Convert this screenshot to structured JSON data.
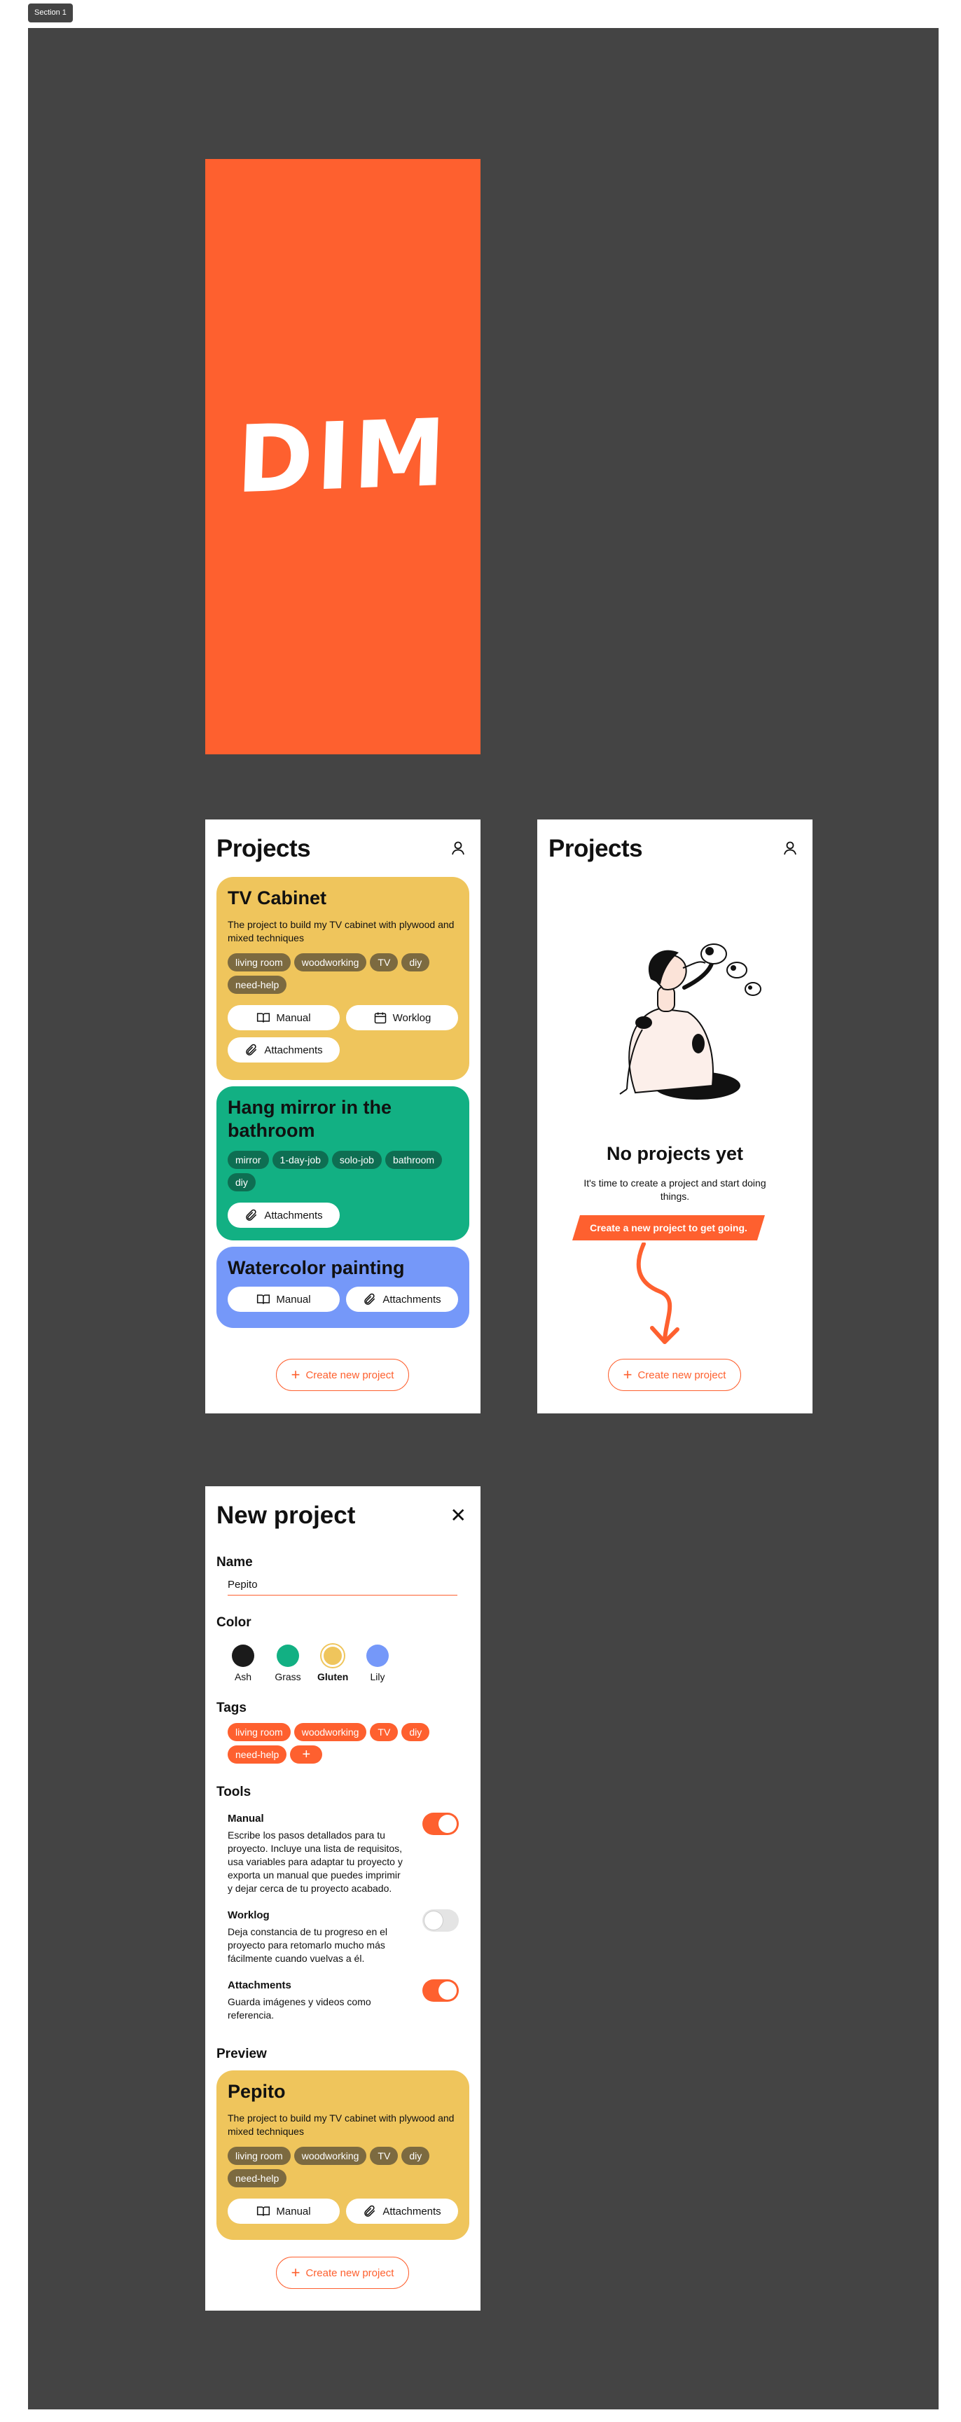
{
  "section_label": "Section 1",
  "splash": {
    "logo": "DIM"
  },
  "projects": {
    "title": "Projects",
    "cards": [
      {
        "title": "TV Cabinet",
        "description": "The project to build my TV cabinet with plywood and mixed techniques",
        "tags": [
          "living room",
          "woodworking",
          "TV",
          "diy",
          "need-help"
        ],
        "buttons": [
          "Manual",
          "Worklog",
          "Attachments"
        ]
      },
      {
        "title": "Hang mirror in the bathroom",
        "tags": [
          "mirror",
          "1-day-job",
          "solo-job",
          "bathroom",
          "diy"
        ],
        "buttons": [
          "Attachments"
        ]
      },
      {
        "title": "Watercolor painting",
        "buttons": [
          "Manual",
          "Attachments"
        ]
      }
    ],
    "create_label": "Create new project"
  },
  "empty": {
    "title": "Projects",
    "heading": "No projects yet",
    "subtitle": "It's time to create a project and start doing things.",
    "cta": "Create a new project to get going.",
    "create_label": "Create new project"
  },
  "new_project": {
    "title": "New project",
    "name_label": "Name",
    "name_value": "Pepito",
    "color_label": "Color",
    "colors": [
      {
        "name": "Ash",
        "hex": "#1b1b1b"
      },
      {
        "name": "Grass",
        "hex": "#12B083"
      },
      {
        "name": "Gluten",
        "hex": "#EFC55C",
        "selected": true
      },
      {
        "name": "Lily",
        "hex": "#7598F9"
      }
    ],
    "tags_label": "Tags",
    "tags": [
      "living room",
      "woodworking",
      "TV",
      "diy",
      "need-help"
    ],
    "add_tag": "+",
    "tools_label": "Tools",
    "tools": [
      {
        "name": "Manual",
        "desc": "Escribe los pasos detallados para tu proyecto. Incluye una lista de requisitos, usa variables para adaptar tu proyecto y exporta un manual que puedes imprimir y dejar cerca de tu proyecto acabado.",
        "on": true
      },
      {
        "name": "Worklog",
        "desc": "Deja constancia de tu progreso en el proyecto para retomarlo mucho más fácilmente cuando vuelvas a él.",
        "on": false
      },
      {
        "name": "Attachments",
        "desc": "Guarda imágenes y videos como referencia.",
        "on": true
      }
    ],
    "preview_label": "Preview",
    "preview": {
      "title": "Pepito",
      "description": "The project to build my TV cabinet with plywood and mixed techniques",
      "tags": [
        "living room",
        "woodworking",
        "TV",
        "diy",
        "need-help"
      ],
      "buttons": [
        "Manual",
        "Attachments"
      ]
    },
    "create_label": "Create new project"
  },
  "colors": {
    "accent": "#FE602F",
    "canvas": "#444444",
    "yellow": "#EFC55C",
    "green": "#12B083",
    "blue": "#7598F9"
  }
}
